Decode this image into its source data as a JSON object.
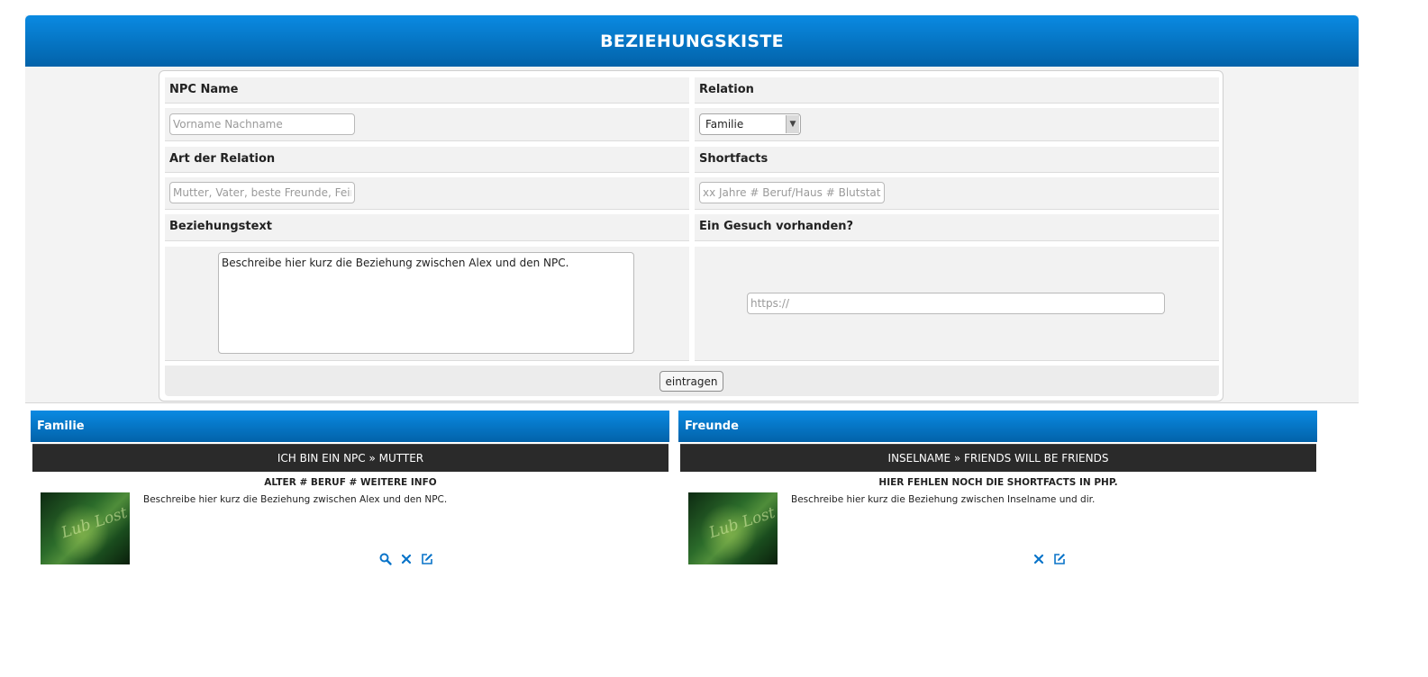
{
  "header": {
    "title": "BEZIEHUNGSKISTE"
  },
  "form": {
    "npc_name_label": "NPC Name",
    "npc_name_placeholder": "Vorname Nachname",
    "relation_label": "Relation",
    "relation_selected": "Familie",
    "art_label": "Art der Relation",
    "art_placeholder": "Mutter, Vater, beste Freunde, Feinde",
    "shortfacts_label": "Shortfacts",
    "shortfacts_placeholder": "xx Jahre # Beruf/Haus # Blutstatus",
    "text_label": "Beziehungstext",
    "text_value": "Beschreibe hier kurz die Beziehung zwischen Alex und den NPC.",
    "gesuch_label": "Ein Gesuch vorhanden?",
    "gesuch_placeholder": "https://",
    "submit_label": "eintragen"
  },
  "categories": [
    {
      "title": "Familie",
      "entries": [
        {
          "heading": "ICH BIN EIN NPC » MUTTER",
          "facts": "ALTER # BERUF # WEITERE INFO",
          "text": "Beschreibe hier kurz die Beziehung zwischen Alex und den NPC.",
          "icons": [
            "search-icon",
            "close-icon",
            "edit-icon"
          ]
        }
      ]
    },
    {
      "title": "Freunde",
      "entries": [
        {
          "heading": "INSELNAME » FRIENDS WILL BE FRIENDS",
          "facts": "HIER FEHLEN NOCH DIE SHORTFACTS IN PHP.",
          "text": "Beschreibe hier kurz die Beziehung zwischen Inselname und dir.",
          "icons": [
            "close-icon",
            "edit-icon"
          ]
        }
      ]
    }
  ],
  "colors": {
    "accent": "#0a7fd4",
    "bar": "#2a2a2a",
    "icon": "#0a74c9"
  }
}
